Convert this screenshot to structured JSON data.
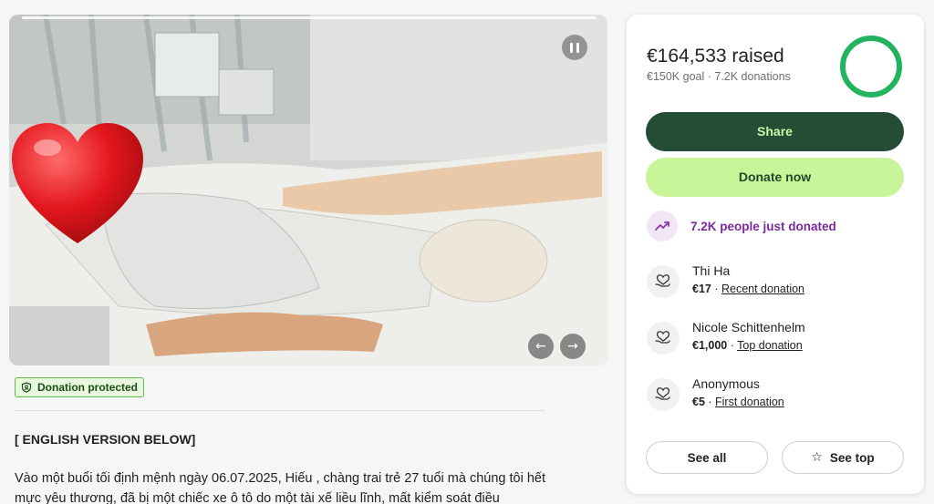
{
  "media": {
    "pause_icon": "pause-icon",
    "prev_icon": "arrow-left-icon",
    "next_icon": "arrow-right-icon",
    "sticker_icon": "red-heart-icon",
    "prev_glyph": "←",
    "next_glyph": "→"
  },
  "badge": {
    "label": "Donation protected",
    "icon": "shield-check-icon"
  },
  "story": {
    "heading": "[ ENGLISH VERSION BELOW]",
    "paragraph": "Vào một buổi tối định mệnh ngày 06.07.2025, Hiếu , chàng trai trẻ 27 tuổi mà chúng tôi hết mực yêu thương, đã bị một chiếc xe ô tô do một tài xế liều lĩnh, mất kiểm soát điều"
  },
  "fundraiser": {
    "raised": "€164,533 raised",
    "goal": "€150K goal",
    "donations": "7.2K donations",
    "progress_percent": 100,
    "accent_color": "#22b35e"
  },
  "actions": {
    "share_label": "Share",
    "donate_label": "Donate now"
  },
  "activity": {
    "text": "7.2K people just donated",
    "icon": "trending-up-icon"
  },
  "donors": [
    {
      "name": "Thi Ha",
      "amount": "€17",
      "kind": "Recent donation",
      "icon": "heart-hand-icon"
    },
    {
      "name": "Nicole Schittenhelm",
      "amount": "€1,000",
      "kind": "Top donation",
      "icon": "heart-hand-icon"
    },
    {
      "name": "Anonymous",
      "amount": "€5",
      "kind": "First donation",
      "icon": "heart-hand-icon"
    }
  ],
  "footer": {
    "see_all_label": "See all",
    "see_top_label": "See top",
    "see_top_icon": "star-icon",
    "star_glyph": "☆"
  },
  "separator": " · "
}
